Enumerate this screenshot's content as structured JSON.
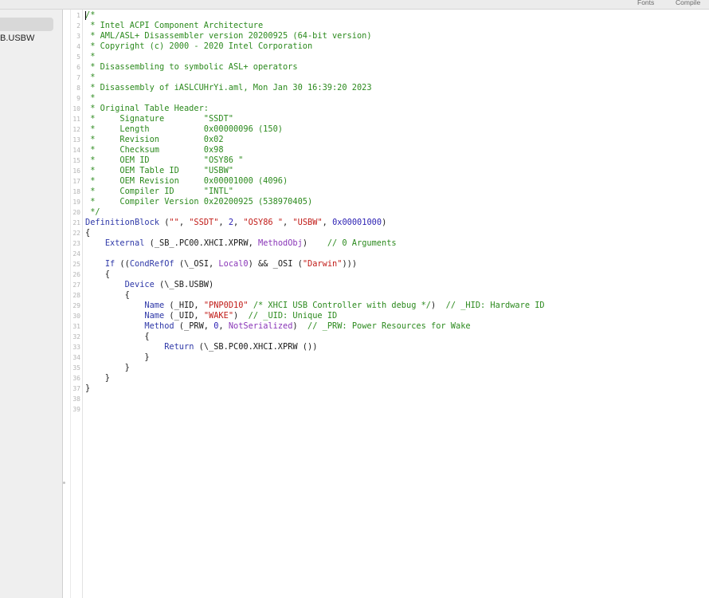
{
  "toolbar": {
    "fonts_label": "Fonts",
    "compile_label": "Compile"
  },
  "sidebar": {
    "items": [
      {
        "label": "B.USBW",
        "selected": true
      }
    ]
  },
  "editor": {
    "line_numbers": [
      "1",
      "2",
      "3",
      "4",
      "5",
      "6",
      "7",
      "8",
      "9",
      "10",
      "11",
      "12",
      "13",
      "14",
      "15",
      "16",
      "17",
      "18",
      "19",
      "20",
      "21",
      "22",
      "23",
      "24",
      "25",
      "26",
      "27",
      "28",
      "29",
      "30",
      "31",
      "32",
      "33",
      "34",
      "35",
      "36",
      "37",
      "38",
      "39"
    ],
    "lines": [
      [
        {
          "t": "/*",
          "c": "com"
        }
      ],
      [
        {
          "t": " * Intel ACPI Component Architecture",
          "c": "com"
        }
      ],
      [
        {
          "t": " * AML/ASL+ Disassembler version 20200925 (64-bit version)",
          "c": "com"
        }
      ],
      [
        {
          "t": " * Copyright (c) 2000 - 2020 Intel Corporation",
          "c": "com"
        }
      ],
      [
        {
          "t": " *",
          "c": "com"
        }
      ],
      [
        {
          "t": " * Disassembling to symbolic ASL+ operators",
          "c": "com"
        }
      ],
      [
        {
          "t": " *",
          "c": "com"
        }
      ],
      [
        {
          "t": " * Disassembly of iASLCUHrYi.aml, Mon Jan 30 16:39:20 2023",
          "c": "com"
        }
      ],
      [
        {
          "t": " *",
          "c": "com"
        }
      ],
      [
        {
          "t": " * Original Table Header:",
          "c": "com"
        }
      ],
      [
        {
          "t": " *     Signature        \"SSDT\"",
          "c": "com"
        }
      ],
      [
        {
          "t": " *     Length           0x00000096 (150)",
          "c": "com"
        }
      ],
      [
        {
          "t": " *     Revision         0x02",
          "c": "com"
        }
      ],
      [
        {
          "t": " *     Checksum         0x98",
          "c": "com"
        }
      ],
      [
        {
          "t": " *     OEM ID           \"OSY86 \"",
          "c": "com"
        }
      ],
      [
        {
          "t": " *     OEM Table ID     \"USBW\"",
          "c": "com"
        }
      ],
      [
        {
          "t": " *     OEM Revision     0x00001000 (4096)",
          "c": "com"
        }
      ],
      [
        {
          "t": " *     Compiler ID      \"INTL\"",
          "c": "com"
        }
      ],
      [
        {
          "t": " *     Compiler Version 0x20200925 (538970405)",
          "c": "com"
        }
      ],
      [
        {
          "t": " */",
          "c": "com"
        }
      ],
      [
        {
          "t": "DefinitionBlock",
          "c": "kw"
        },
        {
          "t": " (",
          "c": "blk"
        },
        {
          "t": "\"\"",
          "c": "str"
        },
        {
          "t": ", ",
          "c": "blk"
        },
        {
          "t": "\"SSDT\"",
          "c": "str"
        },
        {
          "t": ", ",
          "c": "blk"
        },
        {
          "t": "2",
          "c": "num"
        },
        {
          "t": ", ",
          "c": "blk"
        },
        {
          "t": "\"OSY86 \"",
          "c": "str"
        },
        {
          "t": ", ",
          "c": "blk"
        },
        {
          "t": "\"USBW\"",
          "c": "str"
        },
        {
          "t": ", ",
          "c": "blk"
        },
        {
          "t": "0x00001000",
          "c": "num"
        },
        {
          "t": ")",
          "c": "blk"
        }
      ],
      [
        {
          "t": "{",
          "c": "blk"
        }
      ],
      [
        {
          "t": "    ",
          "c": "blk"
        },
        {
          "t": "External",
          "c": "kw"
        },
        {
          "t": " (_SB_.PC00.XHCI.XPRW, ",
          "c": "blk"
        },
        {
          "t": "MethodObj",
          "c": "fn"
        },
        {
          "t": ")    ",
          "c": "blk"
        },
        {
          "t": "// 0 Arguments",
          "c": "com"
        }
      ],
      [],
      [
        {
          "t": "    ",
          "c": "blk"
        },
        {
          "t": "If",
          "c": "kw"
        },
        {
          "t": " ((",
          "c": "blk"
        },
        {
          "t": "CondRefOf",
          "c": "kw"
        },
        {
          "t": " (\\_OSI, ",
          "c": "blk"
        },
        {
          "t": "Local0",
          "c": "fn"
        },
        {
          "t": ") && _OSI (",
          "c": "blk"
        },
        {
          "t": "\"Darwin\"",
          "c": "str"
        },
        {
          "t": ")))",
          "c": "blk"
        }
      ],
      [
        {
          "t": "    {",
          "c": "blk"
        }
      ],
      [
        {
          "t": "        ",
          "c": "blk"
        },
        {
          "t": "Device",
          "c": "kw"
        },
        {
          "t": " (\\_SB.USBW)",
          "c": "blk"
        }
      ],
      [
        {
          "t": "        {",
          "c": "blk"
        }
      ],
      [
        {
          "t": "            ",
          "c": "blk"
        },
        {
          "t": "Name",
          "c": "kw"
        },
        {
          "t": " (_HID, ",
          "c": "blk"
        },
        {
          "t": "\"PNP0D10\"",
          "c": "str"
        },
        {
          "t": " ",
          "c": "blk"
        },
        {
          "t": "/* XHCI USB Controller with debug */",
          "c": "com"
        },
        {
          "t": ")  ",
          "c": "blk"
        },
        {
          "t": "// _HID: Hardware ID",
          "c": "com"
        }
      ],
      [
        {
          "t": "            ",
          "c": "blk"
        },
        {
          "t": "Name",
          "c": "kw"
        },
        {
          "t": " (_UID, ",
          "c": "blk"
        },
        {
          "t": "\"WAKE\"",
          "c": "str"
        },
        {
          "t": ")  ",
          "c": "blk"
        },
        {
          "t": "// _UID: Unique ID",
          "c": "com"
        }
      ],
      [
        {
          "t": "            ",
          "c": "blk"
        },
        {
          "t": "Method",
          "c": "kw"
        },
        {
          "t": " (_PRW, ",
          "c": "blk"
        },
        {
          "t": "0",
          "c": "num"
        },
        {
          "t": ", ",
          "c": "blk"
        },
        {
          "t": "NotSerialized",
          "c": "fn"
        },
        {
          "t": ")  ",
          "c": "blk"
        },
        {
          "t": "// _PRW: Power Resources for Wake",
          "c": "com"
        }
      ],
      [
        {
          "t": "            {",
          "c": "blk"
        }
      ],
      [
        {
          "t": "                ",
          "c": "blk"
        },
        {
          "t": "Return",
          "c": "kw"
        },
        {
          "t": " (\\_SB.PC00.XHCI.XPRW ())",
          "c": "blk"
        }
      ],
      [
        {
          "t": "            }",
          "c": "blk"
        }
      ],
      [
        {
          "t": "        }",
          "c": "blk"
        }
      ],
      [
        {
          "t": "    }",
          "c": "blk"
        }
      ],
      [
        {
          "t": "}",
          "c": "blk"
        }
      ],
      [],
      []
    ]
  },
  "colors": {
    "comment": "#2c8a1e",
    "keyword": "#2f39a8",
    "string": "#c11b17",
    "number": "#2a1fb3",
    "function": "#8a36b8",
    "sidebar_bg": "#efefef",
    "selection": "#d8d8d8"
  }
}
